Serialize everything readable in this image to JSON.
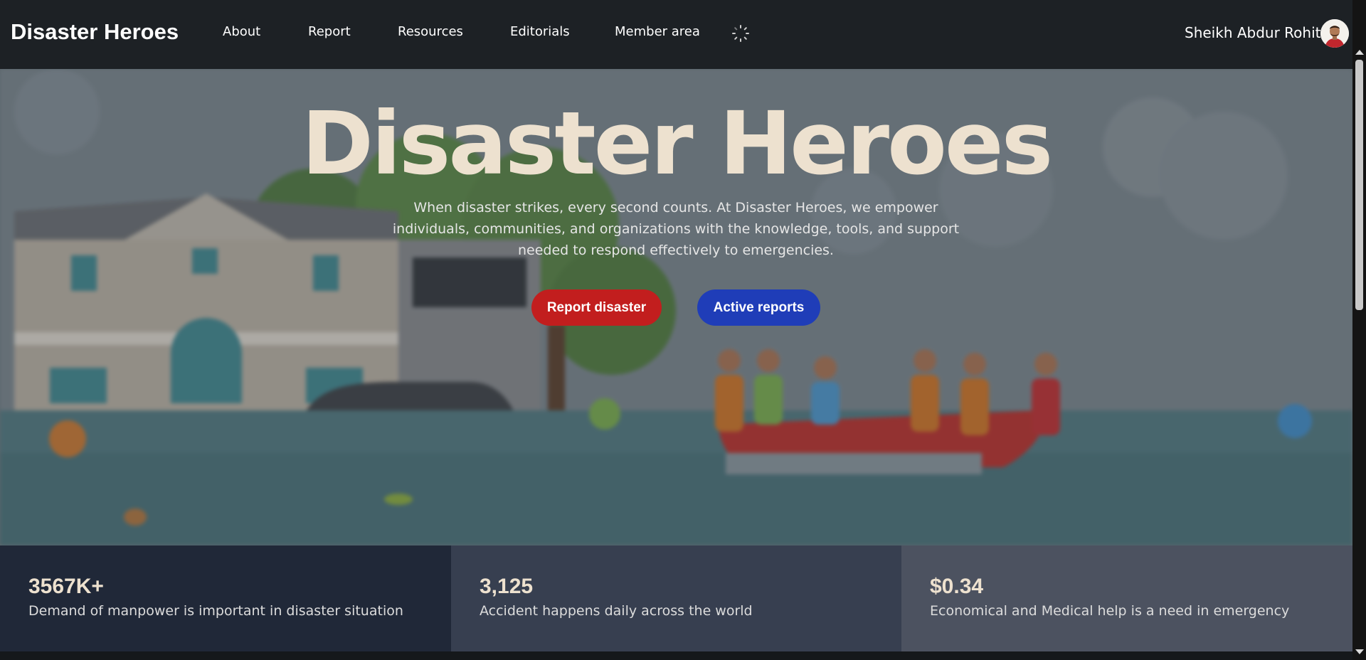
{
  "navbar": {
    "brand": "Disaster Heroes",
    "links": [
      "About",
      "Report",
      "Resources",
      "Editorials",
      "Member area"
    ],
    "loading_icon": "spinner-icon",
    "user_name": "Sheikh Abdur Rohit",
    "avatar_icon": "user-avatar"
  },
  "hero": {
    "title": "Disaster Heroes",
    "description": "When disaster strikes, every second counts. At Disaster Heroes, we empower individuals, communities, and organizations with the knowledge, tools, and support needed to respond effectively to emergencies.",
    "primary_button": "Report disaster",
    "secondary_button": "Active reports"
  },
  "stats": [
    {
      "value": "3567K+",
      "label": "Demand of manpower is important in disaster situation"
    },
    {
      "value": "3,125",
      "label": "Accident happens daily across the world"
    },
    {
      "value": "$0.34",
      "label": "Economical and Medical help is a need in emergency"
    }
  ],
  "colors": {
    "navbar_bg": "#1d2125",
    "title_color": "#ede1cf",
    "report_button": "#c21e1e",
    "active_button": "#1f3db8",
    "stat_bg_1": "#202838",
    "stat_bg_2": "#373f50",
    "stat_bg_3": "#4c5260"
  }
}
